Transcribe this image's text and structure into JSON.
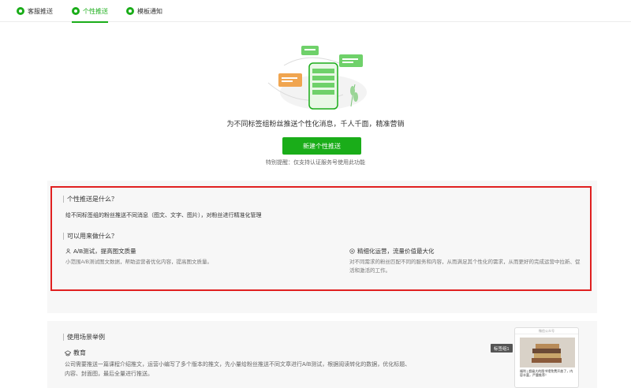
{
  "tabs": [
    {
      "label": "客服推送",
      "active": false
    },
    {
      "label": "个性推送",
      "active": true
    },
    {
      "label": "模板通知",
      "active": false
    }
  ],
  "hero": {
    "title": "为不同标签组粉丝推送个性化消息，千人千面，精准营销",
    "cta": "新建个性推送",
    "note": "特别提醒：仅支持认证服务号使用此功能"
  },
  "info": {
    "what_title": "个性推送是什么？",
    "what_desc": "给不同标签组的粉丝推送不同消息（图文、文字、图片），对粉丝进行精准化管理",
    "use_title": "可以用来做什么？",
    "features": [
      {
        "title": "A/B测试，提高图文质量",
        "desc": "小范围A/B测试图文数据，帮助运营者优化内容，提高图文质量。",
        "icon": "user-icon"
      },
      {
        "title": "精细化运营，流量价值最大化",
        "desc": "对不同需求的粉丝匹配不同的服务和内容，从而满足其个性化的需求，从而更好的完成运营中拉新、促活和激活的工作。",
        "icon": "target-icon"
      }
    ]
  },
  "example": {
    "title": "使用场景举例",
    "category": "教育",
    "desc": "公司需要推送一篇课程介绍推文，运营小编写了多个版本的推文，先小量给粉丝推送不同文章进行A/B测试，根据阅读转化的数据，优化标题、内容、封面图，最后全量进行推送。",
    "tag": "标签组1",
    "mock_header": "微信公众号",
    "mock_caption": "福利 | 超级大的图书馆免费开放了，内容丰富，严重推荐！"
  },
  "colors": {
    "accent": "#1aad19",
    "highlight": "#e02020"
  }
}
